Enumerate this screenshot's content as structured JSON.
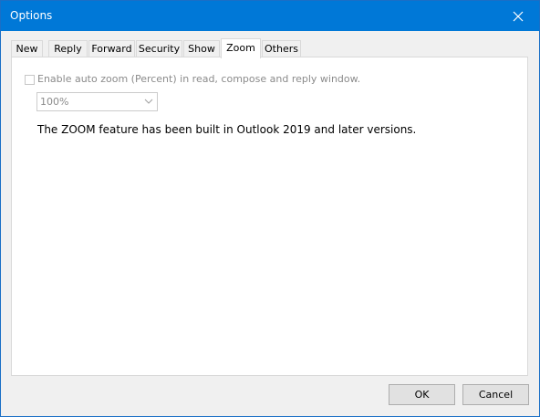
{
  "window": {
    "title": "Options",
    "titlebar_color": "#0078d7",
    "close_icon": "close-icon"
  },
  "tabs": [
    {
      "label": "New",
      "active": false
    },
    {
      "label": "Reply",
      "active": false
    },
    {
      "label": "Forward",
      "active": false
    },
    {
      "label": "Security",
      "active": false
    },
    {
      "label": "Show",
      "active": false
    },
    {
      "label": "Zoom",
      "active": true
    },
    {
      "label": "Others",
      "active": false
    }
  ],
  "zoom_panel": {
    "auto_zoom_checkbox": {
      "label": "Enable auto zoom (Percent) in read, compose and reply window.",
      "checked": false,
      "enabled": false
    },
    "zoom_select": {
      "value": "100%",
      "enabled": false,
      "chevron_icon": "chevron-down-icon"
    },
    "info_text": "The ZOOM feature has been built in Outlook 2019 and later versions."
  },
  "footer": {
    "ok_label": "OK",
    "cancel_label": "Cancel"
  }
}
